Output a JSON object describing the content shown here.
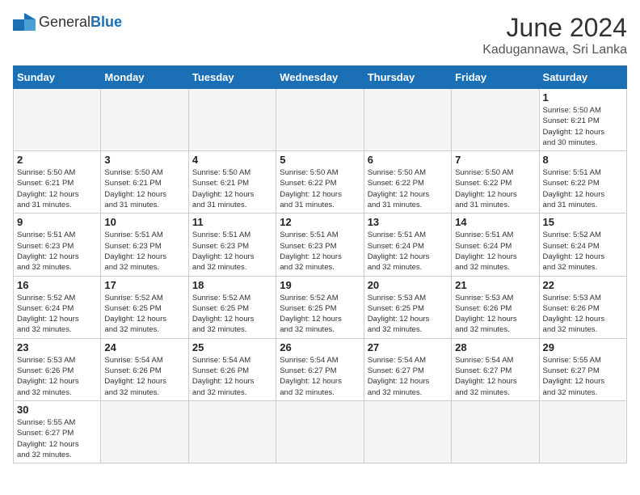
{
  "header": {
    "logo_general": "General",
    "logo_blue": "Blue",
    "title": "June 2024",
    "subtitle": "Kadugannawa, Sri Lanka"
  },
  "weekdays": [
    "Sunday",
    "Monday",
    "Tuesday",
    "Wednesday",
    "Thursday",
    "Friday",
    "Saturday"
  ],
  "days": {
    "1": {
      "sunrise": "5:50 AM",
      "sunset": "6:21 PM",
      "daylight": "12 hours and 30 minutes."
    },
    "2": {
      "sunrise": "5:50 AM",
      "sunset": "6:21 PM",
      "daylight": "12 hours and 31 minutes."
    },
    "3": {
      "sunrise": "5:50 AM",
      "sunset": "6:21 PM",
      "daylight": "12 hours and 31 minutes."
    },
    "4": {
      "sunrise": "5:50 AM",
      "sunset": "6:21 PM",
      "daylight": "12 hours and 31 minutes."
    },
    "5": {
      "sunrise": "5:50 AM",
      "sunset": "6:22 PM",
      "daylight": "12 hours and 31 minutes."
    },
    "6": {
      "sunrise": "5:50 AM",
      "sunset": "6:22 PM",
      "daylight": "12 hours and 31 minutes."
    },
    "7": {
      "sunrise": "5:50 AM",
      "sunset": "6:22 PM",
      "daylight": "12 hours and 31 minutes."
    },
    "8": {
      "sunrise": "5:51 AM",
      "sunset": "6:22 PM",
      "daylight": "12 hours and 31 minutes."
    },
    "9": {
      "sunrise": "5:51 AM",
      "sunset": "6:23 PM",
      "daylight": "12 hours and 32 minutes."
    },
    "10": {
      "sunrise": "5:51 AM",
      "sunset": "6:23 PM",
      "daylight": "12 hours and 32 minutes."
    },
    "11": {
      "sunrise": "5:51 AM",
      "sunset": "6:23 PM",
      "daylight": "12 hours and 32 minutes."
    },
    "12": {
      "sunrise": "5:51 AM",
      "sunset": "6:23 PM",
      "daylight": "12 hours and 32 minutes."
    },
    "13": {
      "sunrise": "5:51 AM",
      "sunset": "6:24 PM",
      "daylight": "12 hours and 32 minutes."
    },
    "14": {
      "sunrise": "5:51 AM",
      "sunset": "6:24 PM",
      "daylight": "12 hours and 32 minutes."
    },
    "15": {
      "sunrise": "5:52 AM",
      "sunset": "6:24 PM",
      "daylight": "12 hours and 32 minutes."
    },
    "16": {
      "sunrise": "5:52 AM",
      "sunset": "6:24 PM",
      "daylight": "12 hours and 32 minutes."
    },
    "17": {
      "sunrise": "5:52 AM",
      "sunset": "6:25 PM",
      "daylight": "12 hours and 32 minutes."
    },
    "18": {
      "sunrise": "5:52 AM",
      "sunset": "6:25 PM",
      "daylight": "12 hours and 32 minutes."
    },
    "19": {
      "sunrise": "5:52 AM",
      "sunset": "6:25 PM",
      "daylight": "12 hours and 32 minutes."
    },
    "20": {
      "sunrise": "5:53 AM",
      "sunset": "6:25 PM",
      "daylight": "12 hours and 32 minutes."
    },
    "21": {
      "sunrise": "5:53 AM",
      "sunset": "6:26 PM",
      "daylight": "12 hours and 32 minutes."
    },
    "22": {
      "sunrise": "5:53 AM",
      "sunset": "6:26 PM",
      "daylight": "12 hours and 32 minutes."
    },
    "23": {
      "sunrise": "5:53 AM",
      "sunset": "6:26 PM",
      "daylight": "12 hours and 32 minutes."
    },
    "24": {
      "sunrise": "5:54 AM",
      "sunset": "6:26 PM",
      "daylight": "12 hours and 32 minutes."
    },
    "25": {
      "sunrise": "5:54 AM",
      "sunset": "6:26 PM",
      "daylight": "12 hours and 32 minutes."
    },
    "26": {
      "sunrise": "5:54 AM",
      "sunset": "6:27 PM",
      "daylight": "12 hours and 32 minutes."
    },
    "27": {
      "sunrise": "5:54 AM",
      "sunset": "6:27 PM",
      "daylight": "12 hours and 32 minutes."
    },
    "28": {
      "sunrise": "5:54 AM",
      "sunset": "6:27 PM",
      "daylight": "12 hours and 32 minutes."
    },
    "29": {
      "sunrise": "5:55 AM",
      "sunset": "6:27 PM",
      "daylight": "12 hours and 32 minutes."
    },
    "30": {
      "sunrise": "5:55 AM",
      "sunset": "6:27 PM",
      "daylight": "12 hours and 32 minutes."
    }
  },
  "labels": {
    "sunrise": "Sunrise:",
    "sunset": "Sunset:",
    "daylight": "Daylight:"
  }
}
